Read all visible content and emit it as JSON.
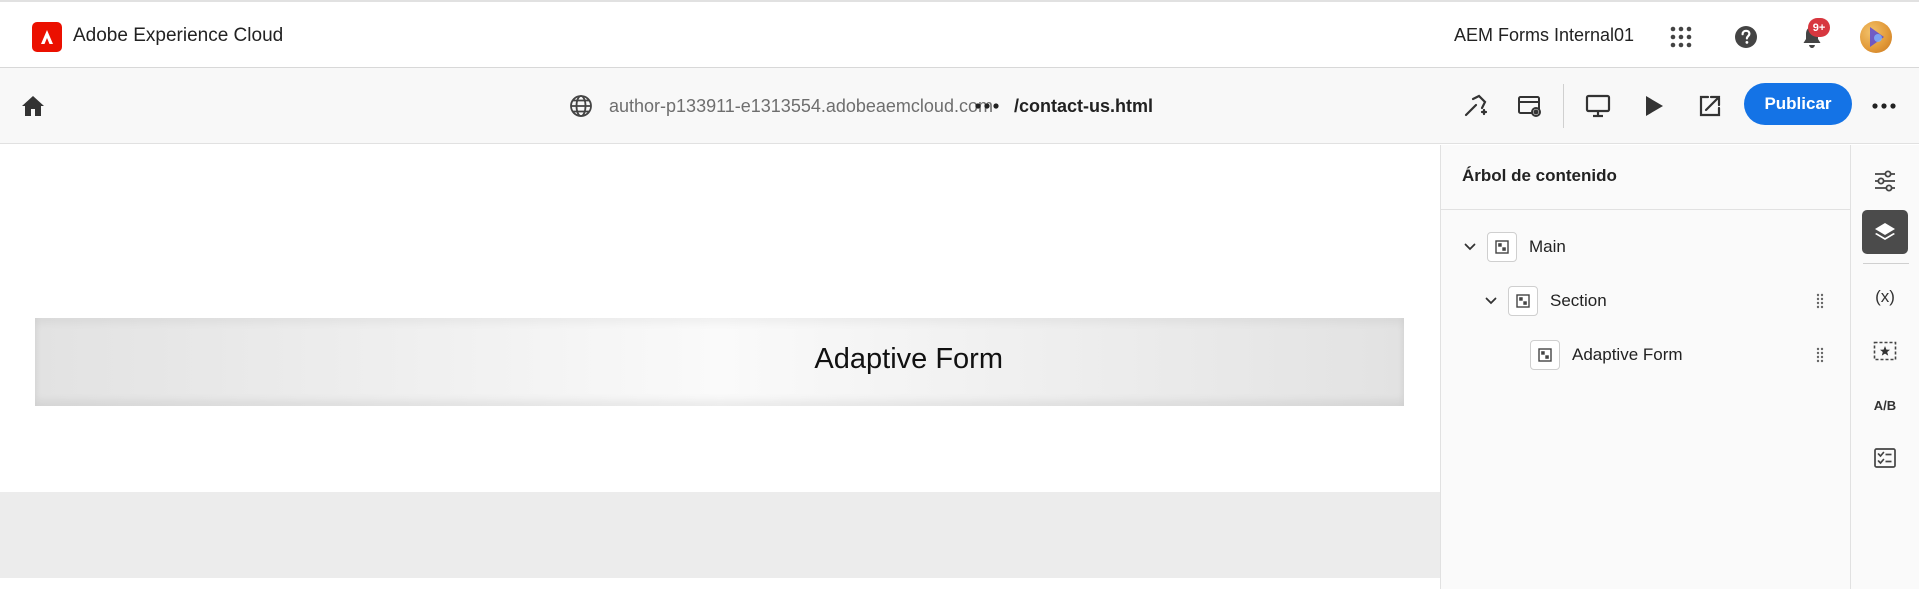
{
  "header": {
    "brand": "Adobe Experience Cloud",
    "org": "AEM Forms Internal01",
    "notification_badge": "9+",
    "icons": [
      "apps-grid-icon",
      "help-icon",
      "bell-icon"
    ]
  },
  "toolbar": {
    "url": "author-p133911-e1313554.adobeaemcloud.com",
    "path": "/contact-us.html",
    "publish_label": "Publicar",
    "icons": [
      "home-icon",
      "globe-icon",
      "more-icon",
      "hammer-icon",
      "page-properties-icon",
      "desktop-preview-icon",
      "play-icon",
      "open-external-icon",
      "more-actions-icon"
    ]
  },
  "canvas": {
    "form_title": "Adaptive Form"
  },
  "content_tree": {
    "title": "Árbol de contenido",
    "nodes": [
      {
        "label": "Main",
        "level": 0,
        "expanded": true
      },
      {
        "label": "Section",
        "level": 1,
        "expanded": true
      },
      {
        "label": "Adaptive Form",
        "level": 2,
        "expanded": false
      }
    ]
  },
  "rail": {
    "variables_label": "(x)",
    "ab_label": "A/B",
    "icons": [
      "properties-icon",
      "layers-icon",
      "variables-icon",
      "fragment-icon",
      "ab-test-icon",
      "checklist-icon"
    ],
    "active": "layers-icon"
  },
  "colors": {
    "accent": "#1473e6",
    "adobe_red": "#eb1000",
    "badge": "#d7373f",
    "rail_active": "#4b4b4b"
  }
}
